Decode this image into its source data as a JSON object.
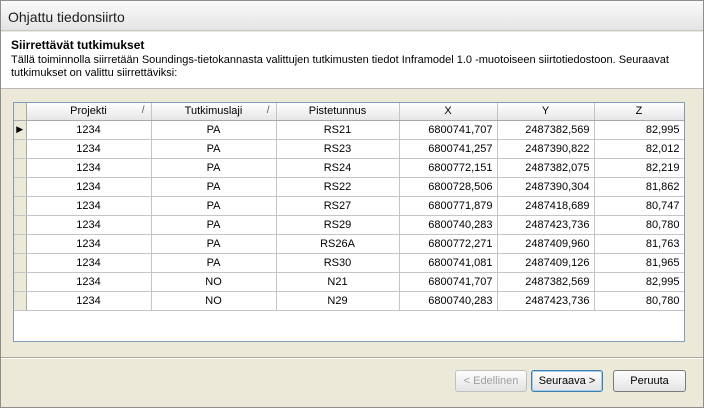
{
  "window": {
    "title": "Ohjattu tiedonsiirto"
  },
  "header": {
    "title": "Siirrettävät tutkimukset",
    "description": "Tällä toiminnolla siirretään Soundings-tietokannasta valittujen tutkimusten tiedot Inframodel 1.0 -muotoiseen siirtotiedostoon. Seuraavat tutkimukset on valittu siirrettäviksi:"
  },
  "grid": {
    "columns": [
      "Projekti",
      "Tutkimuslaji",
      "Pistetunnus",
      "X",
      "Y",
      "Z"
    ],
    "sort_glyph": "/",
    "current_row_glyph": "▶",
    "rows": [
      [
        "1234",
        "PA",
        "RS21",
        "6800741,707",
        "2487382,569",
        "82,995"
      ],
      [
        "1234",
        "PA",
        "RS23",
        "6800741,257",
        "2487390,822",
        "82,012"
      ],
      [
        "1234",
        "PA",
        "RS24",
        "6800772,151",
        "2487382,075",
        "82,219"
      ],
      [
        "1234",
        "PA",
        "RS22",
        "6800728,506",
        "2487390,304",
        "81,862"
      ],
      [
        "1234",
        "PA",
        "RS27",
        "6800771,879",
        "2487418,689",
        "80,747"
      ],
      [
        "1234",
        "PA",
        "RS29",
        "6800740,283",
        "2487423,736",
        "80,780"
      ],
      [
        "1234",
        "PA",
        "RS26A",
        "6800772,271",
        "2487409,960",
        "81,763"
      ],
      [
        "1234",
        "PA",
        "RS30",
        "6800741,081",
        "2487409,126",
        "81,965"
      ],
      [
        "1234",
        "NO",
        "N21",
        "6800741,707",
        "2487382,569",
        "82,995"
      ],
      [
        "1234",
        "NO",
        "N29",
        "6800740,283",
        "2487423,736",
        "80,780"
      ]
    ]
  },
  "buttons": {
    "back": "< Edellinen",
    "next": "Seuraava >",
    "cancel": "Peruuta"
  }
}
